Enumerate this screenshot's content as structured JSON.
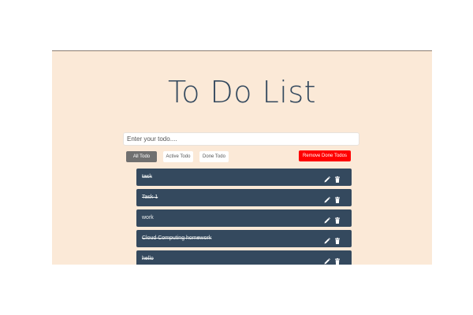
{
  "app": {
    "title": "To Do List",
    "input_placeholder": "Enter your todo....",
    "input_value": ""
  },
  "filters": {
    "all_label": "All Todo",
    "active_label": "Active Todo",
    "done_label": "Done Todo",
    "selected": "All Todo"
  },
  "remove_done_label": "Remove Done Todos",
  "colors": {
    "panel_background": "#fbe9d7",
    "todo_item": "#34495e",
    "remove_button": "#ff0000",
    "active_filter": "#707070"
  },
  "todos": [
    {
      "text": "task",
      "done": true
    },
    {
      "text": "Task 1",
      "done": true
    },
    {
      "text": "work",
      "done": false
    },
    {
      "text": "Cloud Computing homework",
      "done": true
    },
    {
      "text": "hello",
      "done": true
    }
  ],
  "icons": {
    "edit": "pencil-icon",
    "delete": "trash-icon"
  }
}
